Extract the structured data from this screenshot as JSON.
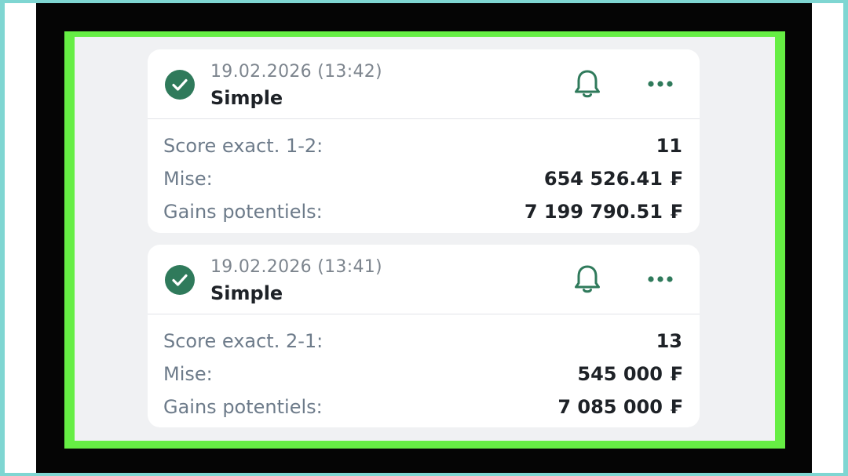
{
  "bets": [
    {
      "date": "19.02.2026 (13:42)",
      "type": "Simple",
      "selection_label": "Score exact. 1-2:",
      "odds": "11",
      "stake_label": "Mise:",
      "stake": "654 526.41 ₣",
      "potential_label": "Gains potentiels:",
      "potential": "7 199 790.51 ₣"
    },
    {
      "date": "19.02.2026 (13:41)",
      "type": "Simple",
      "selection_label": "Score exact. 2-1:",
      "odds": "13",
      "stake_label": "Mise:",
      "stake": "545 000 ₣",
      "potential_label": "Gains potentiels:",
      "potential": "7 085 000 ₣"
    }
  ],
  "icons": {
    "status": "check-circle-icon",
    "notify": "bell-icon",
    "menu": "more-dots-icon"
  },
  "colors": {
    "accent_green": "#2f7a5b",
    "frame_green": "#66ee44",
    "label_gray": "#6d7b8a"
  }
}
